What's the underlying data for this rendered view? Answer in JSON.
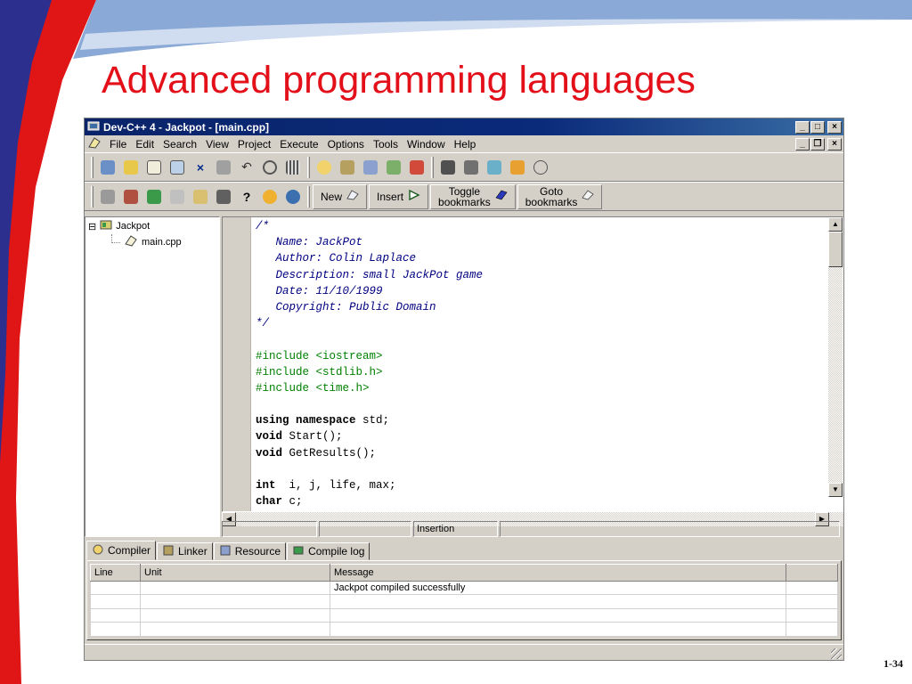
{
  "slide": {
    "title": "Advanced programming languages",
    "page_number": "1-34"
  },
  "window": {
    "title": "Dev-C++ 4 - Jackpot - [main.cpp]",
    "controls": [
      "_",
      "□",
      "×"
    ]
  },
  "menu": {
    "items": [
      "File",
      "Edit",
      "Search",
      "View",
      "Project",
      "Execute",
      "Options",
      "Tools",
      "Window",
      "Help"
    ],
    "underline_first": [
      "F",
      "E",
      "S",
      "V",
      "P",
      "x",
      "O",
      "T",
      "W",
      "H"
    ],
    "mdi_controls": [
      "_",
      "❐",
      "×"
    ]
  },
  "toolbar2": {
    "new_label": "New",
    "insert_label": "Insert",
    "toggle_label_1": "Toggle",
    "toggle_label_2": "bookmarks",
    "goto_label_1": "Goto",
    "goto_label_2": "bookmarks"
  },
  "project_tree": {
    "root": "Jackpot",
    "file": "main.cpp",
    "expander": "⊟"
  },
  "editor": {
    "lines": [
      {
        "text": "/*",
        "kind": "comment"
      },
      {
        "text": "   Name: JackPot",
        "kind": "comment"
      },
      {
        "text": "   Author: Colin Laplace",
        "kind": "comment"
      },
      {
        "text": "   Description: small JackPot game",
        "kind": "comment"
      },
      {
        "text": "   Date: 11/10/1999",
        "kind": "comment"
      },
      {
        "text": "   Copyright: Public Domain",
        "kind": "comment"
      },
      {
        "text": "*/",
        "kind": "comment"
      },
      {
        "text": "",
        "kind": "plain"
      },
      {
        "text": "#include <iostream>",
        "kind": "pre"
      },
      {
        "text": "#include <stdlib.h>",
        "kind": "pre"
      },
      {
        "text": "#include <time.h>",
        "kind": "pre"
      },
      {
        "text": "",
        "kind": "plain"
      },
      {
        "text": "using namespace std;",
        "kind": "kw2",
        "kw": "using namespace",
        "rest": " std;"
      },
      {
        "text": "void Start();",
        "kind": "kw",
        "kw": "void",
        "rest": " Start();"
      },
      {
        "text": "void GetResults();",
        "kind": "kw",
        "kw": "void",
        "rest": " GetResults();"
      },
      {
        "text": "",
        "kind": "plain"
      },
      {
        "text": "int  i, j, life, max;",
        "kind": "kw",
        "kw": "int",
        "rest": "  i, j, life, max;"
      },
      {
        "text": "char c;",
        "kind": "kw",
        "kw": "char",
        "rest": " c;"
      }
    ]
  },
  "statusbar": {
    "panel1": "",
    "panel2": "",
    "mode": "Insertion",
    "panel4": ""
  },
  "bottom_tabs": [
    "Compiler",
    "Linker",
    "Resource",
    "Compile log"
  ],
  "messages": {
    "columns": [
      "Line",
      "Unit",
      "Message"
    ],
    "rows": [
      {
        "line": "",
        "unit": "",
        "message": "Jackpot compiled successfully"
      },
      {
        "line": "",
        "unit": "",
        "message": ""
      },
      {
        "line": "",
        "unit": "",
        "message": ""
      },
      {
        "line": "",
        "unit": "",
        "message": ""
      }
    ]
  },
  "colors": {
    "title_red": "#e3101a",
    "slide_blue": "#8aa9d6",
    "slide_dark_blue": "#2d2f8f",
    "titlebar": "#0a246a",
    "comment": "#000080",
    "preprocessor": "#008000"
  }
}
